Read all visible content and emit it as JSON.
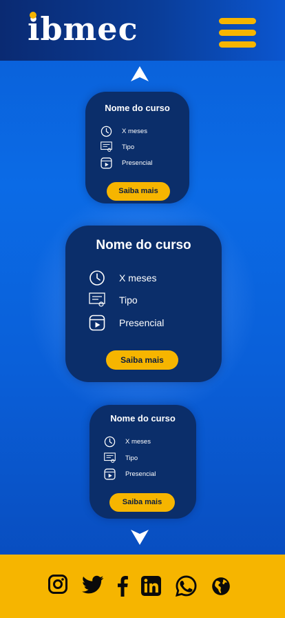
{
  "header": {
    "logo_text": "ibmec",
    "menu_icon": "hamburger-menu-icon",
    "accent_color": "#f6b500"
  },
  "carousel": {
    "prev_icon": "arrow-up-icon",
    "next_icon": "arrow-down-icon",
    "cards": [
      {
        "title": "Nome do curso",
        "duration": "X meses",
        "type": "Tipo",
        "mode": "Presencial",
        "button": "Saiba mais"
      },
      {
        "title": "Nome do curso",
        "duration": "X meses",
        "type": "Tipo",
        "mode": "Presencial",
        "button": "Saiba mais"
      },
      {
        "title": "Nome do curso",
        "duration": "X meses",
        "type": "Tipo",
        "mode": "Presencial",
        "button": "Saiba mais"
      }
    ]
  },
  "footer": {
    "social_icons": [
      "instagram-icon",
      "twitter-icon",
      "facebook-icon",
      "linkedin-icon",
      "whatsapp-icon",
      "globe-icon"
    ],
    "background": "#f6b500"
  }
}
